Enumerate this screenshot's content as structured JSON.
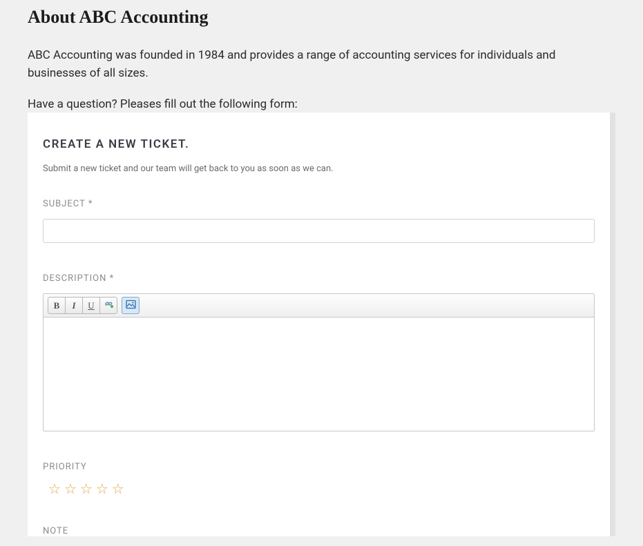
{
  "page": {
    "title": "About ABC Accounting",
    "intro": "ABC Accounting was founded in 1984 and provides a range of accounting services for individuals and businesses of all sizes.",
    "prompt": "Have a question? Pleases fill out the following form:"
  },
  "form": {
    "heading": "CREATE A NEW TICKET.",
    "subtext": "Submit a new ticket and our team will get back to you as soon as we can.",
    "fields": {
      "subject": {
        "label": "SUBJECT *",
        "value": ""
      },
      "description": {
        "label": "DESCRIPTION *",
        "value": ""
      },
      "priority": {
        "label": "PRIORITY",
        "stars_total": 5,
        "stars_filled": 0,
        "glyph_empty": "☆"
      },
      "note": {
        "label": "NOTE"
      }
    },
    "toolbar": {
      "bold": "B",
      "italic": "I",
      "underline": "U"
    }
  }
}
